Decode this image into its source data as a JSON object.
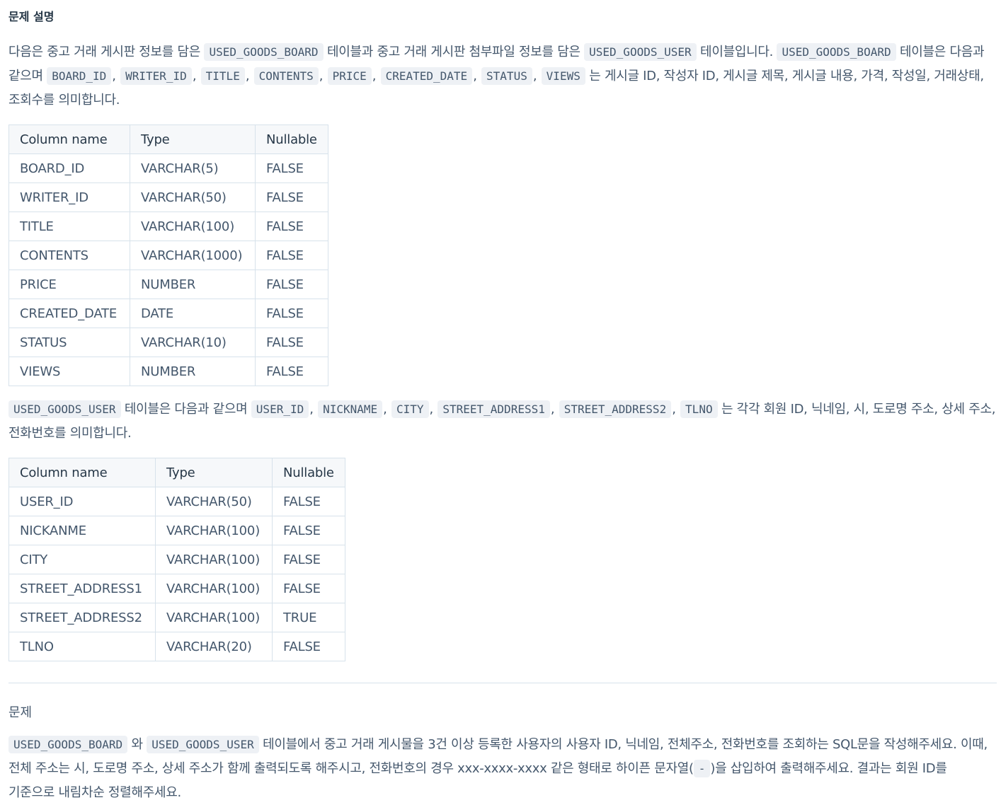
{
  "heading": "문제 설명",
  "intro": {
    "t1": "다음은 중고 거래 게시판 정보를 담은 ",
    "c1": "USED_GOODS_BOARD",
    "t2": " 테이블과 중고 거래 게시판 첨부파일 정보를 담은 ",
    "c2": "USED_GOODS_USER",
    "t3": " 테이블입니다. ",
    "c3": "USED_GOODS_BOARD",
    "t4": " 테이블은 다음과 같으며 ",
    "cols": [
      "BOARD_ID",
      "WRITER_ID",
      "TITLE",
      "CONTENTS",
      "PRICE",
      "CREATED_DATE",
      "STATUS",
      "VIEWS"
    ],
    "t5": " 는 게시글 ID, 작성자 ID, 게시글 제목, 게시글 내용, 가격, 작성일, 거래상태, 조회수를 의미합니다."
  },
  "board_table": {
    "headers": [
      "Column name",
      "Type",
      "Nullable"
    ],
    "rows": [
      [
        "BOARD_ID",
        "VARCHAR(5)",
        "FALSE"
      ],
      [
        "WRITER_ID",
        "VARCHAR(50)",
        "FALSE"
      ],
      [
        "TITLE",
        "VARCHAR(100)",
        "FALSE"
      ],
      [
        "CONTENTS",
        "VARCHAR(1000)",
        "FALSE"
      ],
      [
        "PRICE",
        "NUMBER",
        "FALSE"
      ],
      [
        "CREATED_DATE",
        "DATE",
        "FALSE"
      ],
      [
        "STATUS",
        "VARCHAR(10)",
        "FALSE"
      ],
      [
        "VIEWS",
        "NUMBER",
        "FALSE"
      ]
    ]
  },
  "user_intro": {
    "c1": "USED_GOODS_USER",
    "t1": " 테이블은 다음과 같으며 ",
    "cols": [
      "USER_ID",
      "NICKNAME",
      "CITY",
      "STREET_ADDRESS1",
      "STREET_ADDRESS2",
      "TLNO"
    ],
    "t2": " 는 각각 회원 ID, 닉네임, 시, 도로명 주소, 상세 주소, 전화번호를 의미합니다."
  },
  "user_table": {
    "headers": [
      "Column name",
      "Type",
      "Nullable"
    ],
    "rows": [
      [
        "USER_ID",
        "VARCHAR(50)",
        "FALSE"
      ],
      [
        "NICKANME",
        "VARCHAR(100)",
        "FALSE"
      ],
      [
        "CITY",
        "VARCHAR(100)",
        "FALSE"
      ],
      [
        "STREET_ADDRESS1",
        "VARCHAR(100)",
        "FALSE"
      ],
      [
        "STREET_ADDRESS2",
        "VARCHAR(100)",
        "TRUE"
      ],
      [
        "TLNO",
        "VARCHAR(20)",
        "FALSE"
      ]
    ]
  },
  "problem": {
    "title": "문제",
    "c1": "USED_GOODS_BOARD",
    "t1": " 와 ",
    "c2": "USED_GOODS_USER",
    "t2": " 테이블에서 중고 거래 게시물을 3건 이상 등록한 사용자의 사용자 ID, 닉네임, 전체주소, 전화번호를 조회하는 SQL문을 작성해주세요. 이때, 전체 주소는 시, 도로명 주소, 상세 주소가 함께 출력되도록 해주시고, 전화번호의 경우 xxx-xxxx-xxxx 같은 형태로 하이픈 문자열(",
    "c3": "-",
    "t3": ")을 삽입하여 출력해주세요. 결과는 회원 ID를 기준으로 내림차순 정렬해주세요."
  }
}
